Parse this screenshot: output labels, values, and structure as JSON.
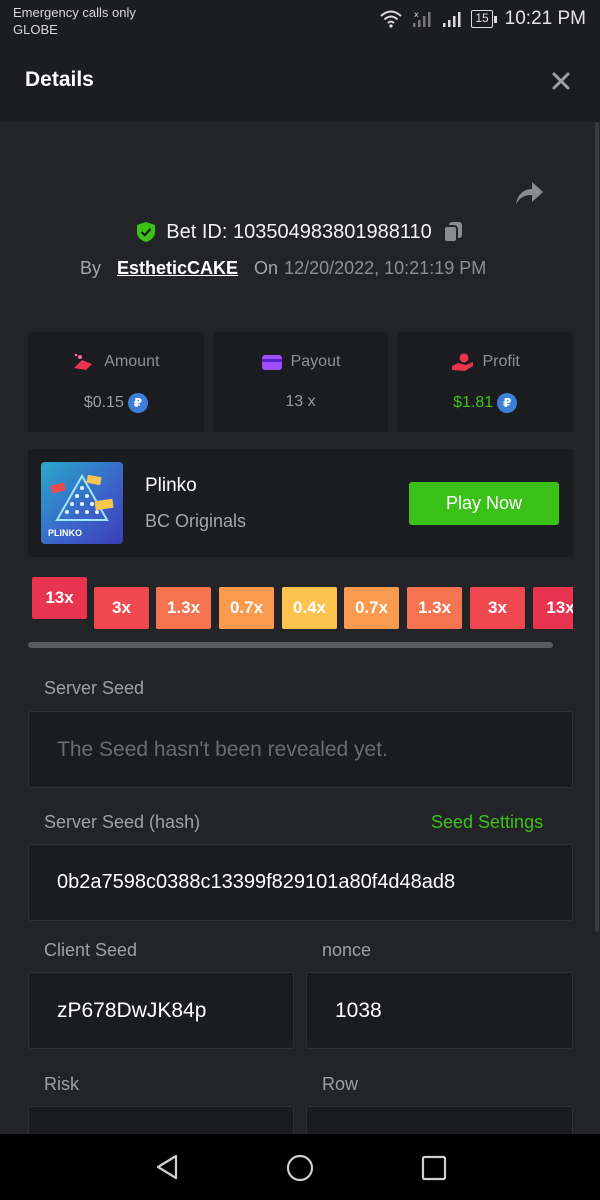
{
  "status_bar": {
    "line1": "Emergency calls only",
    "line2": "GLOBE",
    "battery": "15",
    "time": "10:21 PM"
  },
  "header": {
    "title": "Details",
    "close_icon": "close-icon"
  },
  "bet": {
    "id_text": "Bet ID: 103504983801988110",
    "by_label": "By",
    "user": "EstheticCAKE",
    "on_label": "On",
    "date": "12/20/2022, 10:21:19 PM"
  },
  "stats": {
    "amount_label": "Amount",
    "amount_value": "$0.15",
    "payout_label": "Payout",
    "payout_value": "13 x",
    "profit_label": "Profit",
    "profit_value": "$1.81",
    "coin_symbol": "₽"
  },
  "game": {
    "name": "Plinko",
    "provider": "BC Originals",
    "thumb_label": "PLINKO",
    "play_label": "Play Now"
  },
  "multipliers": [
    {
      "label": "13x",
      "color": "#e8344f"
    },
    {
      "label": "3x",
      "color": "#f04a50"
    },
    {
      "label": "1.3x",
      "color": "#f47350"
    },
    {
      "label": "0.7x",
      "color": "#f99a4e"
    },
    {
      "label": "0.4x",
      "color": "#fbc24d"
    },
    {
      "label": "0.7x",
      "color": "#f99a4e"
    },
    {
      "label": "1.3x",
      "color": "#f47350"
    },
    {
      "label": "3x",
      "color": "#f04a50"
    },
    {
      "label": "13x",
      "color": "#e8344f"
    }
  ],
  "seeds": {
    "server_seed_label": "Server Seed",
    "server_seed_value": "The Seed hasn't been revealed yet.",
    "server_hash_label": "Server Seed (hash)",
    "seed_settings_label": "Seed Settings",
    "server_hash_value": "0b2a7598c0388c13399f829101a80f4d48ad8",
    "client_seed_label": "Client Seed",
    "client_seed_value": "zP678DwJK84p",
    "nonce_label": "nonce",
    "nonce_value": "1038",
    "risk_label": "Risk",
    "row_label": "Row"
  }
}
